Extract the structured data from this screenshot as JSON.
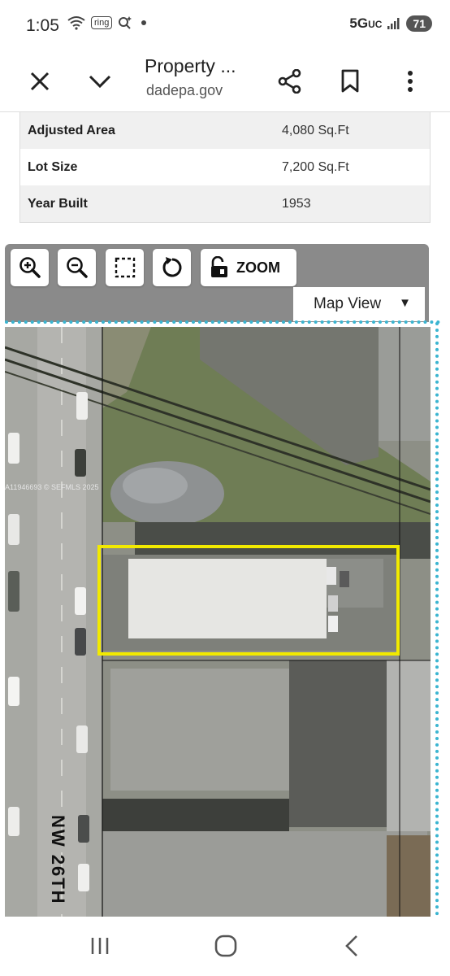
{
  "status_bar": {
    "time": "1:05",
    "ring_badge": "ring",
    "network": "5G",
    "network_sub": "UC",
    "battery": "71"
  },
  "app_bar": {
    "title": "Property ...",
    "url": "dadepa.gov",
    "icons": [
      "close-icon",
      "chevron-down-icon",
      "share-icon",
      "bookmark-icon",
      "more-vert-icon"
    ]
  },
  "property_info": {
    "rows": [
      {
        "label": "Adjusted Area",
        "value": "4,080 Sq.Ft"
      },
      {
        "label": "Lot Size",
        "value": "7,200 Sq.Ft"
      },
      {
        "label": "Year Built",
        "value": "1953"
      }
    ]
  },
  "map_toolbar": {
    "tools": [
      "zoom-in-icon",
      "zoom-out-icon",
      "select-box-icon",
      "refresh-icon"
    ],
    "zoom_label": "ZOOM",
    "view_select": "Map View"
  },
  "map": {
    "street_label": "NW 26TH",
    "watermark": "A11946693 © SEFMLS 2025",
    "highlight_color": "#f2ea00"
  },
  "nav_bar": {
    "icons": [
      "recent-apps-icon",
      "home-icon",
      "back-icon"
    ]
  }
}
